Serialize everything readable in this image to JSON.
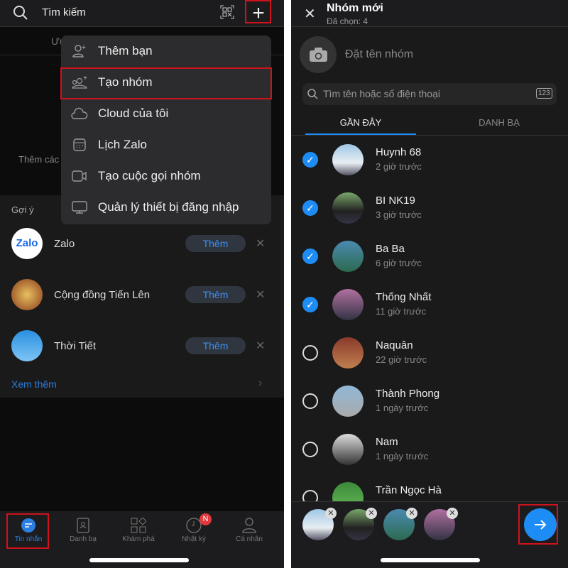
{
  "left": {
    "search_placeholder": "Tìm kiếm",
    "tab_hint": "Ưu",
    "empty_text": "Thêm các",
    "menu": [
      {
        "icon": "add-friend-icon",
        "label": "Thêm bạn"
      },
      {
        "icon": "create-group-icon",
        "label": "Tạo nhóm"
      },
      {
        "icon": "cloud-icon",
        "label": "Cloud của tôi"
      },
      {
        "icon": "calendar-icon",
        "label": "Lịch Zalo"
      },
      {
        "icon": "video-call-icon",
        "label": "Tạo cuộc gọi nhóm"
      },
      {
        "icon": "monitor-icon",
        "label": "Quản lý thiết bị đăng nhập"
      }
    ],
    "suggest_title": "Gợi ý",
    "suggestions": [
      {
        "name": "Zalo",
        "action": "Thêm"
      },
      {
        "name": "Cộng đồng Tiến Lên",
        "action": "Thêm"
      },
      {
        "name": "Thời Tiết",
        "action": "Thêm"
      }
    ],
    "zalo_logo": "Zalo",
    "see_more": "Xem thêm",
    "nav": [
      {
        "label": "Tin nhắn",
        "active": true
      },
      {
        "label": "Danh bạ"
      },
      {
        "label": "Khám phá"
      },
      {
        "label": "Nhật ký",
        "badge": "N"
      },
      {
        "label": "Cá nhân"
      }
    ]
  },
  "right": {
    "title": "Nhóm mới",
    "subtitle": "Đã chọn: 4",
    "group_name_placeholder": "Đặt tên nhóm",
    "search_placeholder": "Tìm tên hoặc số điện thoại",
    "keypad_label": "123",
    "tabs": [
      {
        "label": "GẦN ĐÂY",
        "active": true
      },
      {
        "label": "DANH BẠ"
      }
    ],
    "contacts": [
      {
        "name": "Huynh 68",
        "time": "2 giờ trước",
        "checked": true
      },
      {
        "name": "BI NK19",
        "time": "3 giờ trước",
        "checked": true
      },
      {
        "name": "Ba Ba",
        "time": "6 giờ trước",
        "checked": true
      },
      {
        "name": "Thống Nhất",
        "time": "11 giờ trước",
        "checked": true
      },
      {
        "name": "Naquân",
        "time": "22 giờ trước",
        "checked": false
      },
      {
        "name": "Thành Phong",
        "time": "1 ngày trước",
        "checked": false
      },
      {
        "name": "Nam",
        "time": "1 ngày trước",
        "checked": false
      },
      {
        "name": "Trần Ngọc Hà",
        "time": "",
        "checked": false
      }
    ]
  },
  "colors": {
    "accent": "#1d8df5",
    "highlight": "#d0121b",
    "badge": "#e0393e"
  }
}
